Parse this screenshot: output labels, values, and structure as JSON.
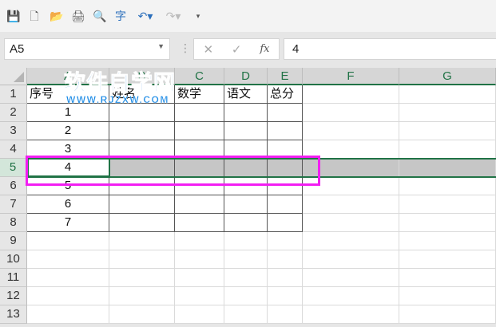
{
  "toolbar": {
    "icons": [
      "save-icon",
      "new-file-icon",
      "open-folder-icon",
      "print-icon",
      "print-preview-icon",
      "spell-check-icon",
      "undo-icon",
      "redo-icon",
      "customize-icon"
    ]
  },
  "formula_bar": {
    "name_box": "A5",
    "cancel": "✕",
    "enter": "✓",
    "fx": "fx",
    "value": "4"
  },
  "columns": [
    "A",
    "B",
    "C",
    "D",
    "E",
    "F",
    "G"
  ],
  "rows": [
    "1",
    "2",
    "3",
    "4",
    "5",
    "6",
    "7",
    "8",
    "9",
    "10",
    "11",
    "12",
    "13"
  ],
  "table": {
    "headers": [
      "序号",
      "姓名",
      "数学",
      "语文",
      "总分"
    ],
    "ids": [
      "1",
      "2",
      "3",
      "4",
      "5",
      "6",
      "7"
    ]
  },
  "watermark": {
    "title": "软件自学网",
    "url": "WWW.RJZXW.COM"
  },
  "colors": {
    "accent": "#217346",
    "highlight": "#f21ef2"
  }
}
